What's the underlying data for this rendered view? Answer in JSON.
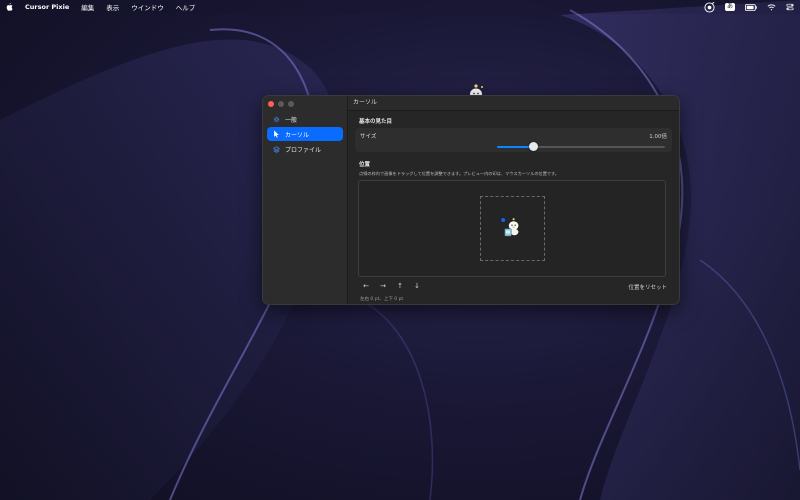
{
  "menubar": {
    "app_name": "Cursor Pixie",
    "items": [
      "編集",
      "表示",
      "ウインドウ",
      "ヘルプ"
    ],
    "input_badge": "あ"
  },
  "window": {
    "sidebar": {
      "items": [
        {
          "label": "一般",
          "icon": "gear-icon",
          "active": false
        },
        {
          "label": "カーソル",
          "icon": "cursor-arrow-icon",
          "active": true
        },
        {
          "label": "プロファイル",
          "icon": "profile-layers-icon",
          "active": false
        }
      ]
    },
    "title": "カーソル",
    "appearance": {
      "section_title": "基本の見た目",
      "size_label": "サイズ",
      "size_value": "1.00倍",
      "size_slider_fraction": 0.22
    },
    "position": {
      "section_title": "位置",
      "hint": "点線の枠内で画像をドラッグして位置を調整できます。プレビュー内の印は、マウスカーソルの位置です。",
      "arrow_left": "←",
      "arrow_right": "→",
      "arrow_up": "↑",
      "arrow_down": "↓",
      "reset_label": "位置をリセット",
      "offset_readout": "左右 0 pt、上下 0 pt"
    }
  },
  "colors": {
    "accent": "#0a6cff",
    "close": "#ff5f57",
    "window_bg": "#262626"
  }
}
